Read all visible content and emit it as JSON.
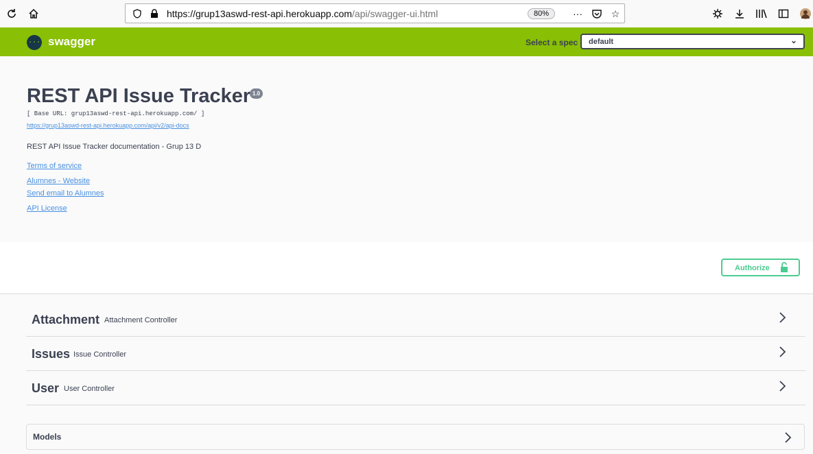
{
  "browser": {
    "url_host": "https://grup13aswd-rest-api.herokuapp.com",
    "url_path": "/api/swagger-ui.html",
    "zoom": "80%"
  },
  "topbar": {
    "logo_text": "swagger",
    "logo_glyph": "{···}",
    "spec_label": "Select a spec",
    "spec_value": "default"
  },
  "info": {
    "title": "REST API Issue Tracker",
    "version": "1.0",
    "base_url": "[ Base URL: grup13aswd-rest-api.herokuapp.com/ ]",
    "docs_link": "https://grup13aswd-rest-api.herokuapp.com/api/v2/api-docs",
    "description": "REST API Issue Tracker documentation - Grup 13 D",
    "links": {
      "terms": "Terms of service",
      "website": "Alumnes - Website",
      "email": "Send email to Alumnes",
      "license": "API License"
    }
  },
  "authorize": {
    "label": "Authorize"
  },
  "tags": [
    {
      "name": "Attachment",
      "description": "Attachment Controller"
    },
    {
      "name": "Issues",
      "description": "Issue Controller"
    },
    {
      "name": "User",
      "description": "User Controller"
    }
  ],
  "models": {
    "title": "Models"
  },
  "colors": {
    "topbar": "#89bf04",
    "authorize": "#49cc90",
    "link": "#4990e2"
  }
}
